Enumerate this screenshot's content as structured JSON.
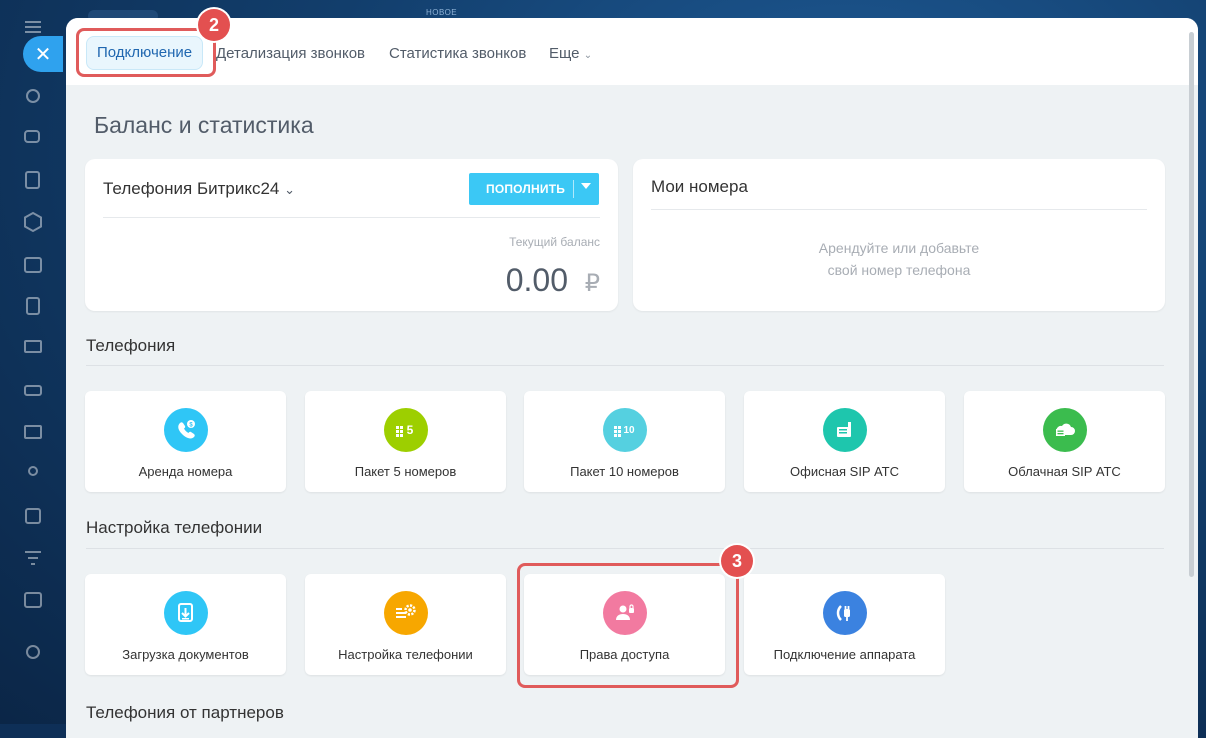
{
  "header": {
    "new_label": "НОВОЕ"
  },
  "tabs": [
    {
      "label": "Подключение"
    },
    {
      "label": "Детализация звонков"
    },
    {
      "label": "Статистика звонков"
    },
    {
      "label": "Еще"
    }
  ],
  "callouts": {
    "tabs_badge": "2",
    "access_badge": "3"
  },
  "page_title": "Баланс и статистика",
  "balance_card": {
    "title": "Телефония Битрикс24",
    "topup_label": "ПОПОЛНИТЬ",
    "balance_label": "Текущий баланс",
    "balance_value": "0.00",
    "currency": "₽"
  },
  "numbers_card": {
    "title": "Мои номера",
    "empty_line1": "Арендуйте или добавьте",
    "empty_line2": "свой номер телефона"
  },
  "sections": {
    "telephony": "Телефония",
    "settings": "Настройка телефонии",
    "partners": "Телефония от партнеров"
  },
  "telephony_tiles": [
    {
      "label": "Аренда номера",
      "color": "#2fc6f6",
      "icon": "phone-rent-icon"
    },
    {
      "label": "Пакет 5 номеров",
      "color": "#9dcf00",
      "icon": "five-numbers-icon"
    },
    {
      "label": "Пакет 10 номеров",
      "color": "#55d0e0",
      "icon": "ten-numbers-icon"
    },
    {
      "label": "Офисная SIP АТС",
      "color": "#1ec6ad",
      "icon": "office-pbx-icon"
    },
    {
      "label": "Облачная SIP АТС",
      "color": "#3bbc4e",
      "icon": "cloud-pbx-icon"
    }
  ],
  "settings_tiles": [
    {
      "label": "Загрузка документов",
      "color": "#2fc6f6",
      "icon": "document-upload-icon"
    },
    {
      "label": "Настройка телефонии",
      "color": "#f7a700",
      "icon": "settings-icon"
    },
    {
      "label": "Права доступа",
      "color": "#f27aa0",
      "icon": "access-rights-icon"
    },
    {
      "label": "Подключение аппарата",
      "color": "#3b82e0",
      "icon": "device-connect-icon"
    }
  ]
}
